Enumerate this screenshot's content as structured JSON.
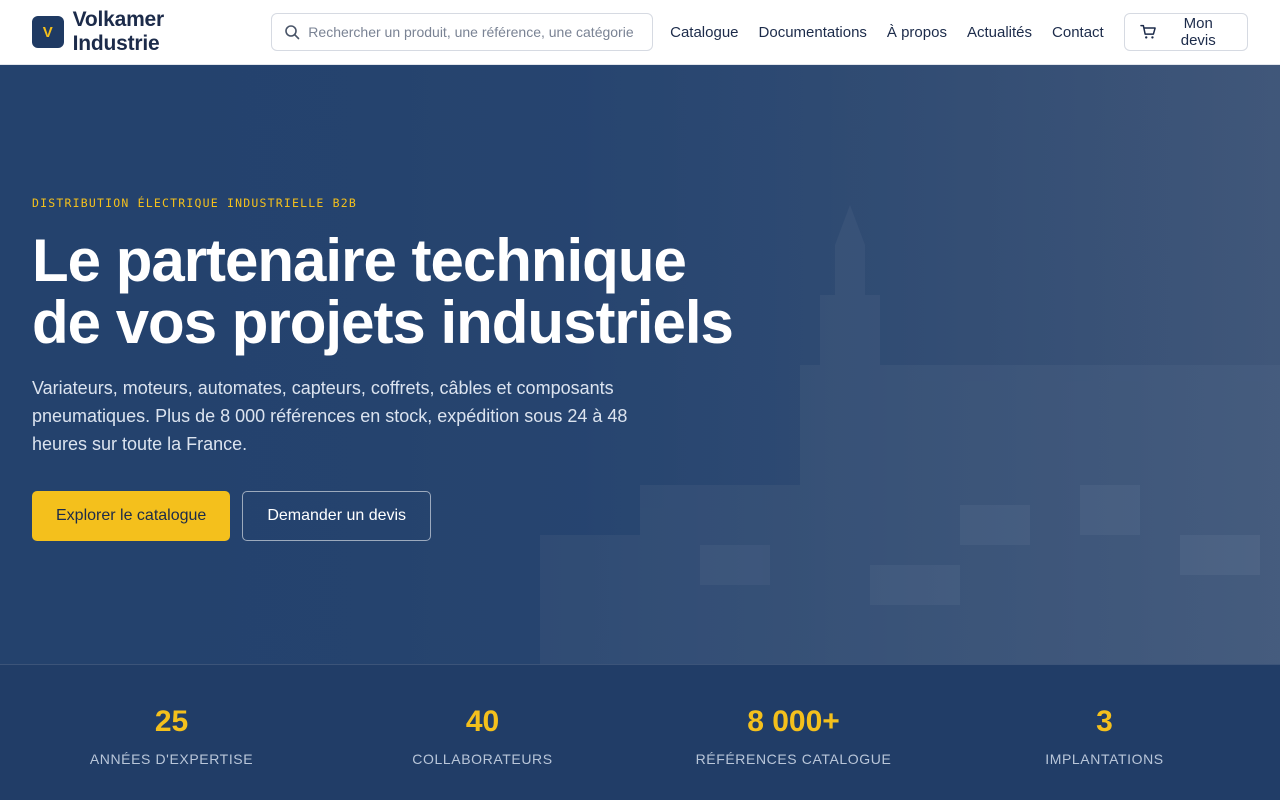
{
  "brand": {
    "mark": "V",
    "name": "Volkamer Industrie"
  },
  "search": {
    "placeholder": "Rechercher un produit, une référence, une catégorie",
    "value": ""
  },
  "nav": {
    "catalogue": "Catalogue",
    "documentations": "Documentations",
    "apropos": "À propos",
    "actualites": "Actualités",
    "contact": "Contact"
  },
  "quote_button": "Mon devis",
  "hero": {
    "eyebrow": "Distribution électrique industrielle B2B",
    "title_line1": "Le partenaire technique",
    "title_line2": "de vos projets industriels",
    "subtitle": "Variateurs, moteurs, automates, capteurs, coffrets, câbles et composants pneumatiques. Plus de 8 000 références en stock, expédition sous 24 à 48 heures sur toute la France.",
    "cta_primary": "Explorer le catalogue",
    "cta_secondary": "Demander un devis"
  },
  "stats": [
    {
      "value": "25",
      "label": "Années d'expertise"
    },
    {
      "value": "40",
      "label": "Collaborateurs"
    },
    {
      "value": "8 000+",
      "label": "Références catalogue"
    },
    {
      "value": "3",
      "label": "Implantations"
    }
  ],
  "colors": {
    "accent": "#f4c01c",
    "navy": "#1f3a63",
    "hero_overlay": "#24426d",
    "stats_bg": "#213d67"
  },
  "icons": {
    "search": "search-icon",
    "cart": "cart-icon"
  }
}
